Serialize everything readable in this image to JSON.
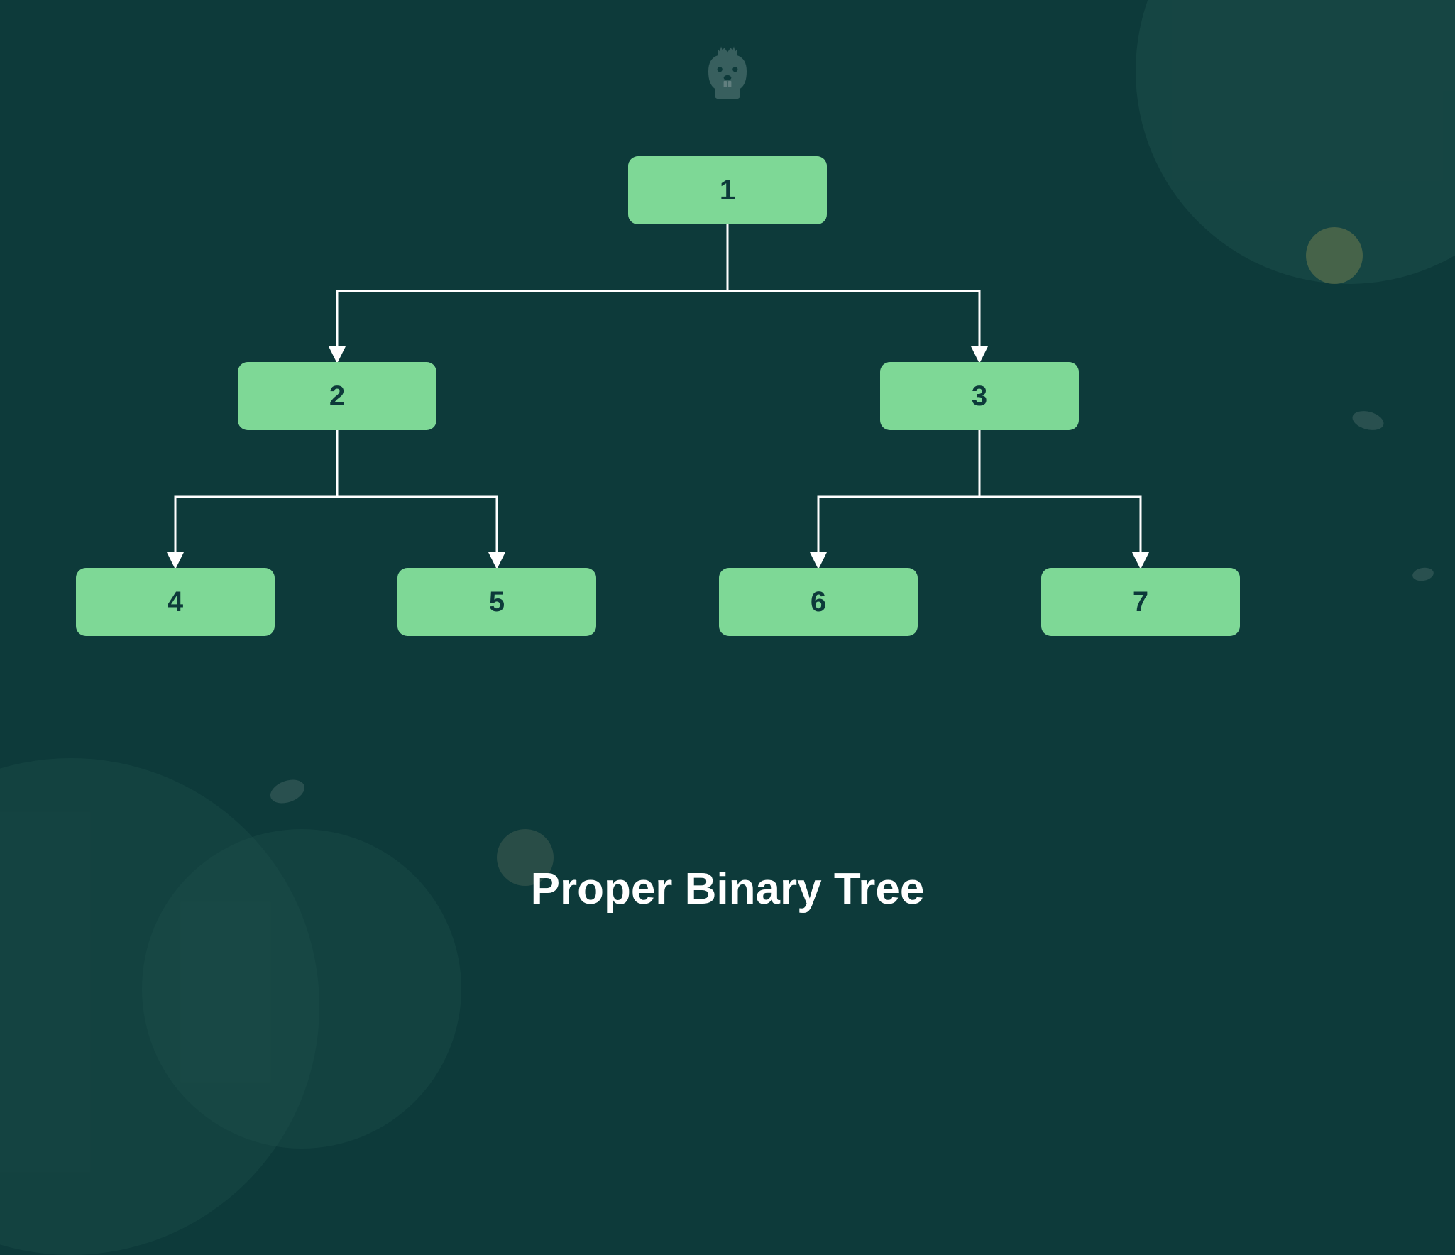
{
  "title": "Proper Binary Tree",
  "logo_name": "beaver-mascot",
  "colors": {
    "background": "#0d3a3a",
    "node_fill": "#7ed896",
    "node_text": "#0d3a3a",
    "edge": "#ffffff",
    "title": "#ffffff"
  },
  "tree": {
    "type": "proper_binary_tree",
    "nodes": [
      {
        "id": "n1",
        "label": "1",
        "level": 0,
        "parent": null
      },
      {
        "id": "n2",
        "label": "2",
        "level": 1,
        "parent": "n1"
      },
      {
        "id": "n3",
        "label": "3",
        "level": 1,
        "parent": "n1"
      },
      {
        "id": "n4",
        "label": "4",
        "level": 2,
        "parent": "n2"
      },
      {
        "id": "n5",
        "label": "5",
        "level": 2,
        "parent": "n2"
      },
      {
        "id": "n6",
        "label": "6",
        "level": 2,
        "parent": "n3"
      },
      {
        "id": "n7",
        "label": "7",
        "level": 2,
        "parent": "n3"
      }
    ],
    "edges": [
      {
        "from": "n1",
        "to": "n2"
      },
      {
        "from": "n1",
        "to": "n3"
      },
      {
        "from": "n2",
        "to": "n4"
      },
      {
        "from": "n2",
        "to": "n5"
      },
      {
        "from": "n3",
        "to": "n6"
      },
      {
        "from": "n3",
        "to": "n7"
      }
    ]
  }
}
